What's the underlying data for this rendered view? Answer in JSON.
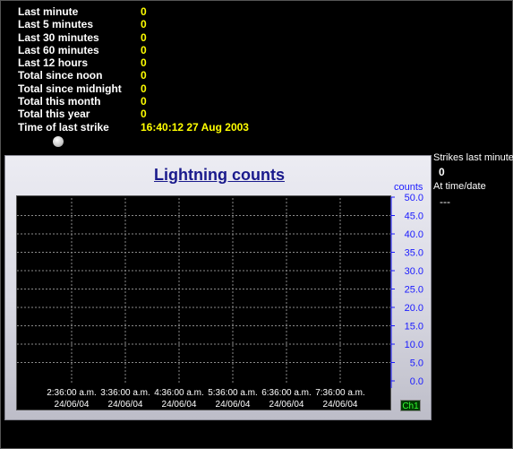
{
  "stats": [
    {
      "label": "Last minute",
      "value": "0"
    },
    {
      "label": "Last 5 minutes",
      "value": "0"
    },
    {
      "label": "Last 30 minutes",
      "value": "0"
    },
    {
      "label": "Last 60 minutes",
      "value": "0"
    },
    {
      "label": "Last 12 hours",
      "value": "0"
    },
    {
      "label": "Total since noon",
      "value": "0"
    },
    {
      "label": "Total since midnight",
      "value": "0"
    },
    {
      "label": "Total this month",
      "value": "0"
    },
    {
      "label": "Total this year",
      "value": "0"
    },
    {
      "label": "Time of last strike",
      "value": "16:40:12 27 Aug 2003"
    }
  ],
  "right_panel": {
    "strikes_label": "Strikes last minute",
    "strikes_value": "0",
    "time_label": "At time/date",
    "time_value": "---"
  },
  "chart_data": {
    "type": "line",
    "title": "Lightning counts",
    "ylabel": "counts",
    "ylim": [
      0,
      50
    ],
    "y_ticks": [
      "50.0",
      "45.0",
      "40.0",
      "35.0",
      "30.0",
      "25.0",
      "20.0",
      "15.0",
      "10.0",
      "5.0",
      "0.0"
    ],
    "x_ticks": [
      {
        "time": "2:36:00 a.m.",
        "date": "24/06/04"
      },
      {
        "time": "3:36:00 a.m.",
        "date": "24/06/04"
      },
      {
        "time": "4:36:00 a.m.",
        "date": "24/06/04"
      },
      {
        "time": "5:36:00 a.m.",
        "date": "24/06/04"
      },
      {
        "time": "6:36:00 a.m.",
        "date": "24/06/04"
      },
      {
        "time": "7:36:00 a.m.",
        "date": "24/06/04"
      }
    ],
    "series": [
      {
        "name": "Ch1",
        "values": []
      }
    ],
    "grid": true,
    "colors": {
      "grid": "#8a8a8a",
      "ticks": "#1a1aff",
      "title": "#1a1a8c",
      "plot_bg": "#000000"
    }
  }
}
